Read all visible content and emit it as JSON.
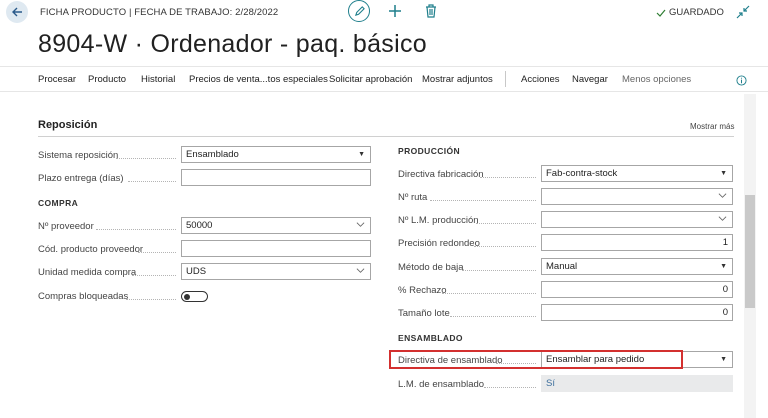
{
  "header": {
    "breadcrumb": "FICHA PRODUCTO | FECHA DE TRABAJO: 2/28/2022",
    "saved_label": "GUARDADO",
    "title": "8904-W · Ordenador - paq. básico"
  },
  "icons": {
    "back": "back-arrow-icon",
    "edit": "pencil-icon",
    "new": "plus-icon",
    "delete": "trash-icon",
    "saved": "checkmark-icon",
    "collapse": "collapse-arrows-icon",
    "info": "info-icon"
  },
  "actionbar": {
    "items": [
      "Procesar",
      "Producto",
      "Historial",
      "Precios de venta...tos especiales",
      "Solicitar aprobación",
      "Mostrar adjuntos"
    ],
    "items2": [
      "Acciones",
      "Navegar",
      "Menos opciones"
    ]
  },
  "section": {
    "title": "Reposición",
    "show_more": "Mostrar más"
  },
  "left": {
    "sistema_reposicion": {
      "label": "Sistema reposición",
      "value": "Ensamblado"
    },
    "plazo_entrega": {
      "label": "Plazo entrega (días)",
      "value": ""
    },
    "compra_head": "COMPRA",
    "n_proveedor": {
      "label": "Nº proveedor",
      "value": "50000"
    },
    "cod_producto_proveedor": {
      "label": "Cód. producto proveedor",
      "value": ""
    },
    "unidad_medida_compra": {
      "label": "Unidad medida compra",
      "value": "UDS"
    },
    "compras_bloqueadas": {
      "label": "Compras bloqueadas",
      "value": false
    }
  },
  "right": {
    "produccion_head": "PRODUCCIÓN",
    "directiva_fabricacion": {
      "label": "Directiva fabricación",
      "value": "Fab-contra-stock"
    },
    "n_ruta": {
      "label": "Nº ruta",
      "value": ""
    },
    "n_lm_produccion": {
      "label": "Nº L.M. producción",
      "value": ""
    },
    "precision_redondeo": {
      "label": "Precisión redondeo",
      "value": "1"
    },
    "metodo_baja": {
      "label": "Método de baja",
      "value": "Manual"
    },
    "rechazo": {
      "label": "% Rechazo",
      "value": "0"
    },
    "tamano_lote": {
      "label": "Tamaño lote",
      "value": "0"
    },
    "ensamblado_head": "ENSAMBLADO",
    "directiva_ensamblado": {
      "label": "Directiva de ensamblado",
      "value": "Ensamblar para pedido"
    },
    "lm_ensamblado": {
      "label": "L.M. de ensamblado",
      "value": "Sí"
    }
  },
  "colors": {
    "accent": "#1f7f8c",
    "highlight_border": "#d3302f",
    "readonly_bg": "#e9eaeb",
    "link_text": "#3d6f9d"
  }
}
